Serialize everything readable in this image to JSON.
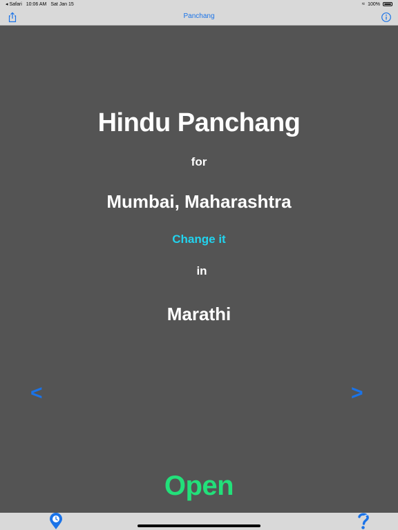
{
  "status_bar": {
    "back_app": "◂ Safari",
    "time": "10:06 AM",
    "date": "Sat Jan 15",
    "battery": "100%"
  },
  "nav": {
    "title": "Panchang",
    "left_icon": "share-icon",
    "right_icon": "info-icon"
  },
  "main": {
    "title": "Hindu Panchang",
    "for_label": "for",
    "city": "Mumbai, Maharashtra",
    "change_link": "Change it",
    "in_label": "in",
    "language": "Marathi",
    "prev_label": "<",
    "next_label": ">",
    "open_label": "Open"
  },
  "tab_bar": {
    "left_icon": "location-clock-icon",
    "right_icon": "help-icon"
  },
  "colors": {
    "background": "#545454",
    "accent": "#1a73e8",
    "link": "#22d3ee",
    "open": "#22e07a"
  }
}
